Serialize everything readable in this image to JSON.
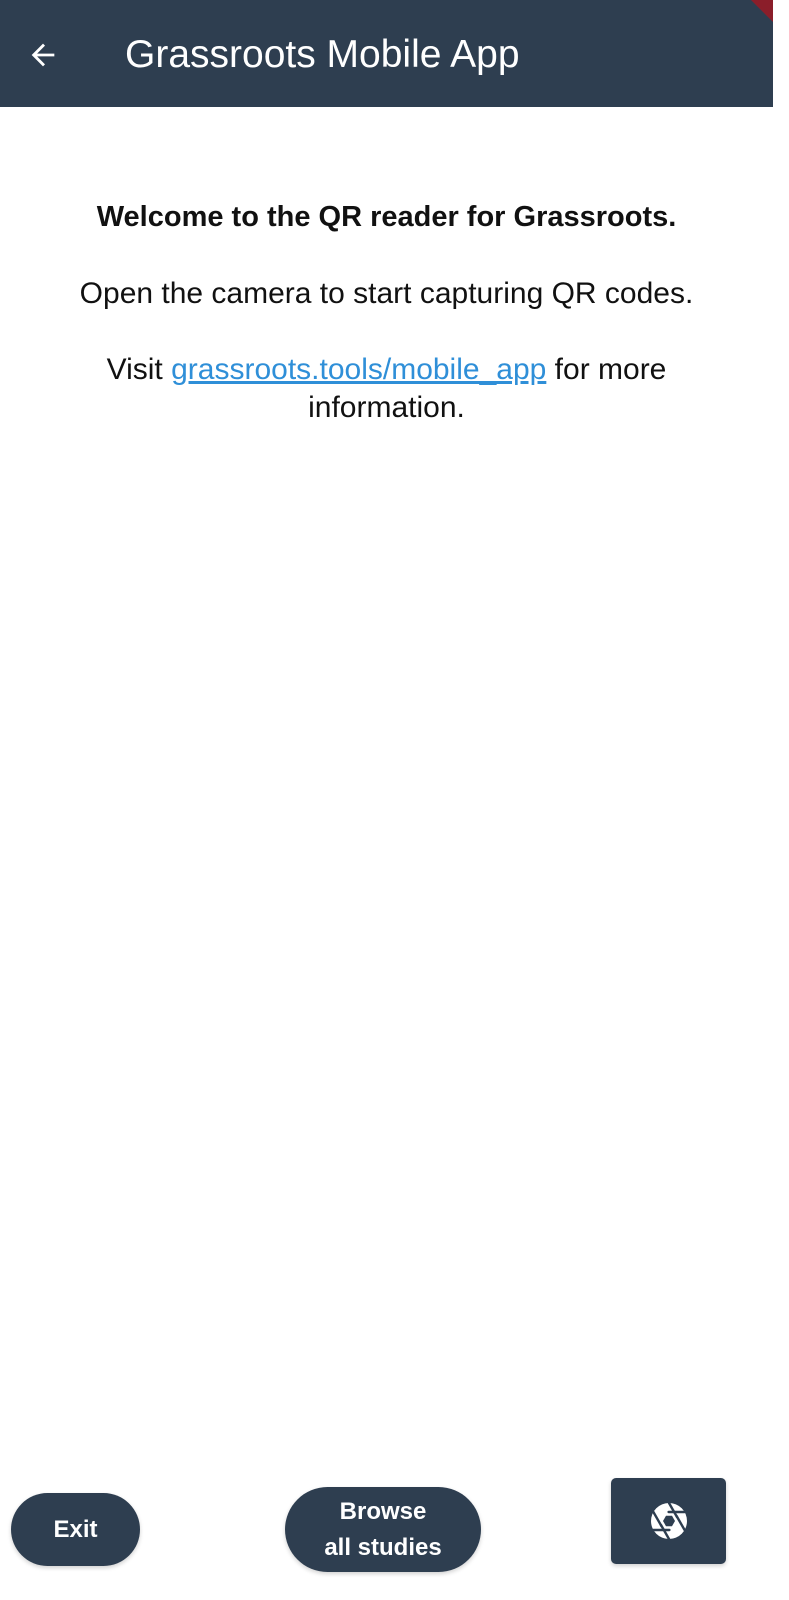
{
  "appbar": {
    "title": "Grassroots Mobile App",
    "back_icon": "arrow-back-icon",
    "background_color": "#2e3e50"
  },
  "content": {
    "welcome": "Welcome to the QR reader for Grassroots.",
    "instructions": "Open the camera to start capturing QR codes.",
    "visit_prefix": "Visit",
    "link_text": "grassroots.tools/mobile_app",
    "visit_suffix": "for more information.",
    "link_color": "#2f8fd8"
  },
  "buttons": {
    "exit_label": "Exit",
    "browse_line1": "Browse",
    "browse_line2": "all studies",
    "camera_icon": "camera-shutter-icon"
  }
}
